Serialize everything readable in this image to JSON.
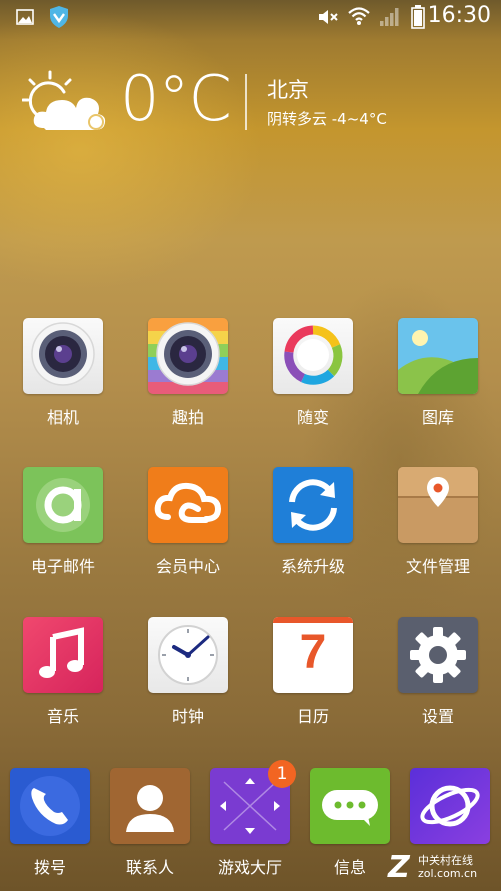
{
  "status_bar": {
    "time": "16:30",
    "icons": [
      "gallery-notification-icon",
      "security-shield-icon",
      "mute-icon",
      "wifi-icon",
      "signal-icon",
      "battery-icon"
    ]
  },
  "weather": {
    "temperature": "0°C",
    "city": "北京",
    "forecast": "阴转多云 -4~4°C",
    "icon": "partly-cloudy-icon"
  },
  "apps": [
    {
      "label": "相机",
      "icon": "camera-icon"
    },
    {
      "label": "趣拍",
      "icon": "fun-camera-icon"
    },
    {
      "label": "随变",
      "icon": "theme-ring-icon"
    },
    {
      "label": "图库",
      "icon": "gallery-icon"
    },
    {
      "label": "电子邮件",
      "icon": "email-icon"
    },
    {
      "label": "会员中心",
      "icon": "cloud-member-icon"
    },
    {
      "label": "系统升级",
      "icon": "system-update-icon"
    },
    {
      "label": "文件管理",
      "icon": "file-manager-icon"
    },
    {
      "label": "音乐",
      "icon": "music-icon"
    },
    {
      "label": "时钟",
      "icon": "clock-icon"
    },
    {
      "label": "日历",
      "icon": "calendar-icon"
    },
    {
      "label": "设置",
      "icon": "settings-icon"
    }
  ],
  "calendar_day": "7",
  "dock": [
    {
      "label": "拨号",
      "icon": "phone-icon"
    },
    {
      "label": "联系人",
      "icon": "contacts-icon"
    },
    {
      "label": "游戏大厅",
      "icon": "game-hall-icon",
      "badge": "1"
    },
    {
      "label": "信息",
      "icon": "messages-icon"
    },
    {
      "label": "",
      "icon": "browser-icon"
    }
  ],
  "watermark": {
    "letter": "Z",
    "line1": "中关村在线",
    "line2": "zol.com.cn"
  }
}
